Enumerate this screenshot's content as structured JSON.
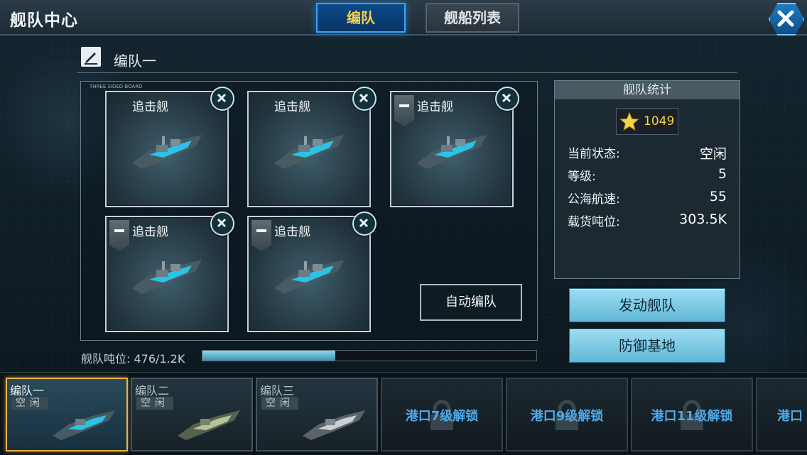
{
  "header": {
    "title": "舰队中心",
    "tabs": [
      {
        "label": "编队",
        "active": true
      },
      {
        "label": "舰船列表",
        "active": false
      }
    ]
  },
  "fleet": {
    "name": "编队一",
    "grid_label": "THREE SIDED BOARD",
    "ships": [
      {
        "name": "追击舰",
        "tagged": false
      },
      {
        "name": "追击舰",
        "tagged": false
      },
      {
        "name": "追击舰",
        "tagged": true
      },
      {
        "name": "追击舰",
        "tagged": true
      },
      {
        "name": "追击舰",
        "tagged": true
      }
    ],
    "auto_button": "自动编队",
    "tonnage_label": "舰队吨位: 476/1.2K",
    "tonnage_fraction": 0.397
  },
  "stats": {
    "title": "舰队统计",
    "power": "1049",
    "rows": [
      {
        "label": "当前状态:",
        "value": "空闲"
      },
      {
        "label": "等级:",
        "value": "5"
      },
      {
        "label": "公海航速:",
        "value": "55"
      },
      {
        "label": "载货吨位:",
        "value": "303.5K"
      }
    ]
  },
  "actions": {
    "launch": "发动舰队",
    "defend": "防御基地"
  },
  "slots": [
    {
      "name": "编队一",
      "status": "空闲",
      "active": true
    },
    {
      "name": "编队二",
      "status": "空闲",
      "active": false
    },
    {
      "name": "编队三",
      "status": "空闲",
      "active": false
    }
  ],
  "locked_slots": [
    {
      "label": "港口7级解锁"
    },
    {
      "label": "港口9级解锁"
    },
    {
      "label": "港口11级解锁"
    },
    {
      "label": "港口"
    }
  ],
  "colors": {
    "accent_blue": "#36a3ff",
    "tab_active_text": "#f9d34a",
    "power_gold": "#f5d548",
    "button_blue": "#9fdcf3",
    "lock_text": "#4fa8e8"
  },
  "icons": {
    "close": "close-icon",
    "edit": "edit-icon",
    "remove": "remove-icon",
    "star": "star-icon",
    "lock": "lock-icon"
  }
}
